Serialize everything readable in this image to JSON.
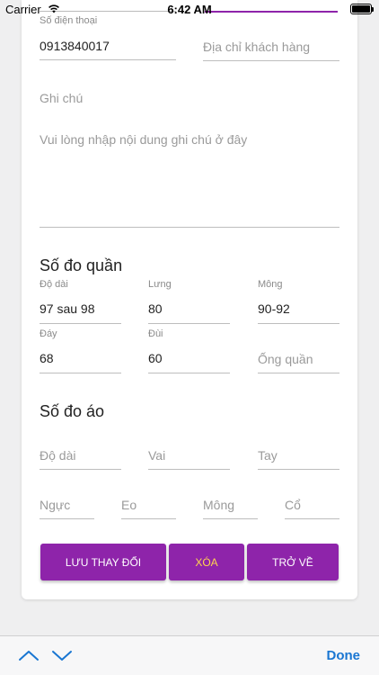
{
  "status_bar": {
    "carrier": "Carrier",
    "time": "6:42 AM"
  },
  "contact": {
    "phone": {
      "label": "Số điện thoại",
      "value": "0913840017"
    },
    "address": {
      "placeholder": "Địa chỉ khách hàng"
    },
    "note": {
      "label": "Ghi chú",
      "placeholder": "Vui lòng nhập nội dung ghi chú ở đây"
    }
  },
  "pants_section": {
    "title": "Số đo quần",
    "fields": {
      "length": {
        "label": "Độ dài",
        "value": "97 sau 98"
      },
      "waist": {
        "label": "Lưng",
        "value": "80"
      },
      "hips": {
        "label": "Mông",
        "value": "90-92"
      },
      "bottom": {
        "label": "Đáy",
        "value": "68"
      },
      "thigh": {
        "label": "Đùi",
        "value": "60"
      },
      "leg_opening": {
        "placeholder": "Ống quần"
      }
    }
  },
  "shirt_section": {
    "title": "Số đo áo",
    "fields": {
      "length": {
        "placeholder": "Độ dài"
      },
      "shoulder": {
        "placeholder": "Vai"
      },
      "sleeve": {
        "placeholder": "Tay"
      },
      "chest": {
        "placeholder": "Ngực"
      },
      "waist": {
        "placeholder": "Eo"
      },
      "hips": {
        "placeholder": "Mông"
      },
      "neck": {
        "placeholder": "Cổ"
      }
    }
  },
  "actions": {
    "save": "LƯU THAY ĐỔI",
    "delete": "XÓA",
    "back": "TRỞ VỀ"
  },
  "keyboard_accessory": {
    "done": "Done"
  },
  "colors": {
    "accent": "#8e24aa",
    "delete_text": "#ffd54f",
    "done": "#1976d2"
  }
}
